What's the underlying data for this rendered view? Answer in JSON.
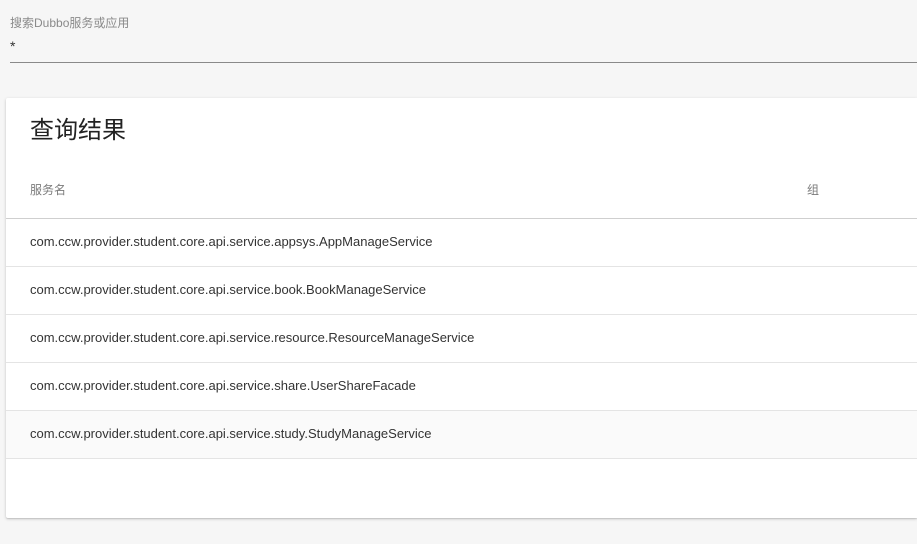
{
  "search": {
    "label": "搜索Dubbo服务或应用",
    "value": "*"
  },
  "results": {
    "title": "查询结果",
    "columns": {
      "service": "服务名",
      "group": "组"
    },
    "rows": [
      {
        "service": "com.ccw.provider.student.core.api.service.appsys.AppManageService",
        "group": ""
      },
      {
        "service": "com.ccw.provider.student.core.api.service.book.BookManageService",
        "group": ""
      },
      {
        "service": "com.ccw.provider.student.core.api.service.resource.ResourceManageService",
        "group": ""
      },
      {
        "service": "com.ccw.provider.student.core.api.service.share.UserShareFacade",
        "group": ""
      },
      {
        "service": "com.ccw.provider.student.core.api.service.study.StudyManageService",
        "group": ""
      }
    ]
  }
}
